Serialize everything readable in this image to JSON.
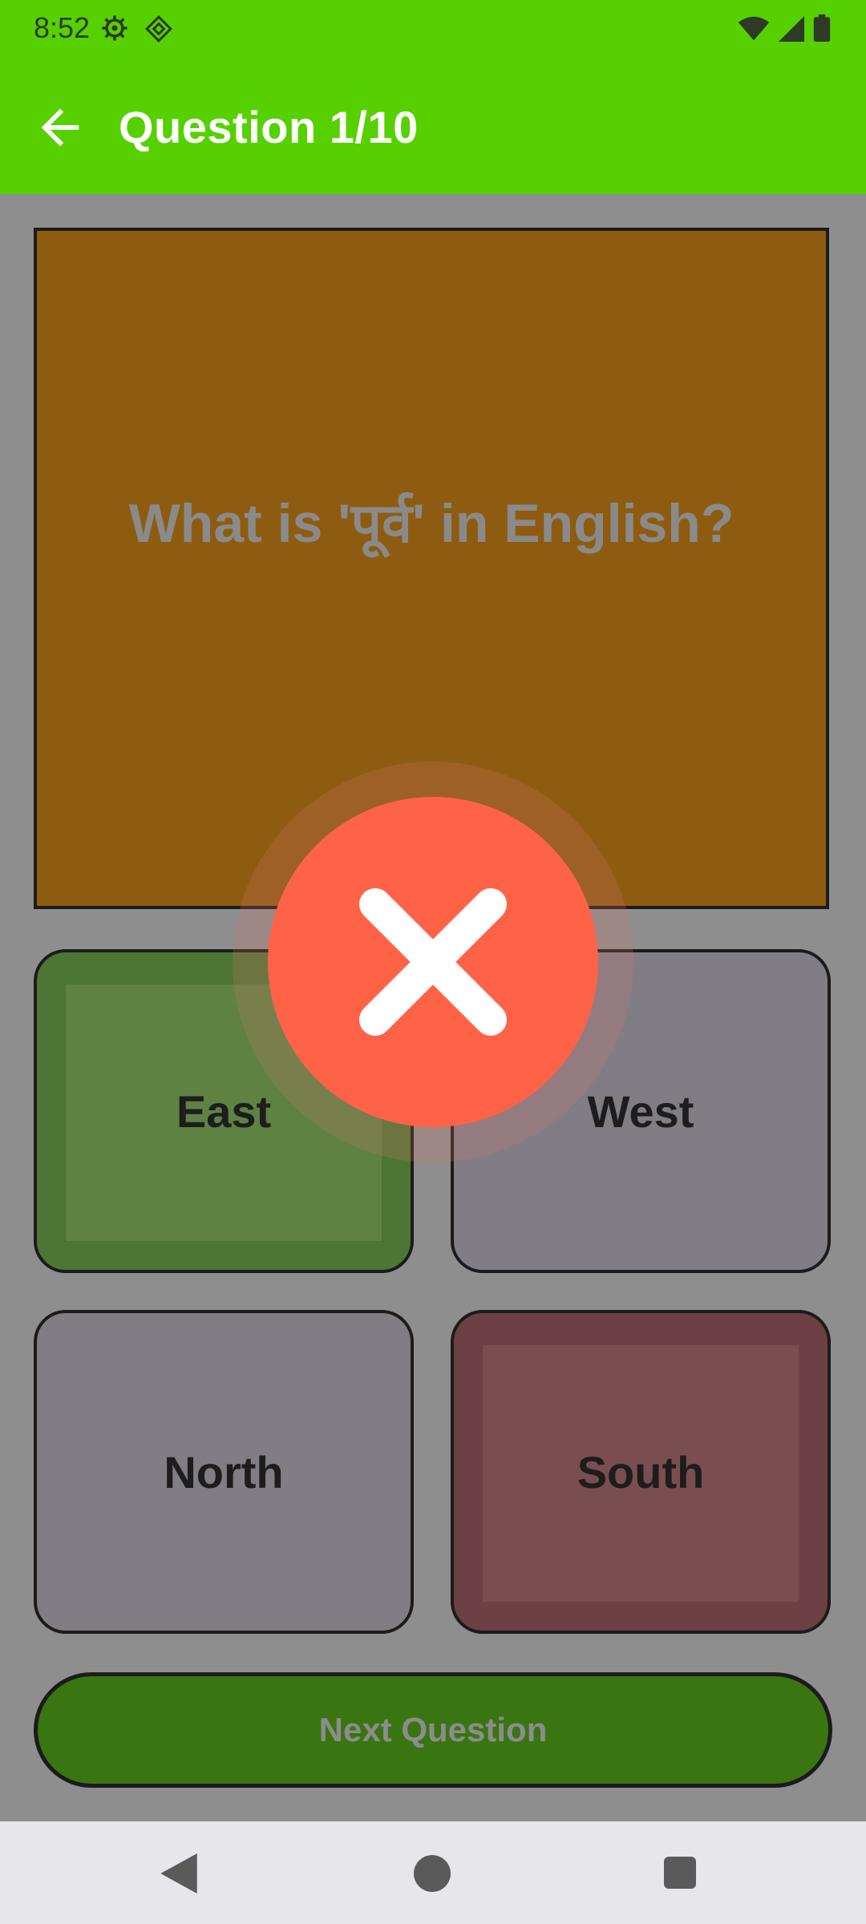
{
  "status_bar": {
    "time": "8:52",
    "left_icons": [
      "settings-icon",
      "notification-icon"
    ],
    "right_icons": [
      "wifi-icon",
      "signal-icon",
      "battery-icon"
    ]
  },
  "app_bar": {
    "title": "Question 1/10",
    "back_icon": "arrow-back-icon",
    "color": "#57d000"
  },
  "question": {
    "text": "What is 'पूर्व' in English?"
  },
  "options": [
    {
      "label": "East",
      "state": "correct"
    },
    {
      "label": "West",
      "state": "neutral"
    },
    {
      "label": "North",
      "state": "neutral"
    },
    {
      "label": "South",
      "state": "wrong-selected"
    }
  ],
  "next_button": {
    "label": "Next Question"
  },
  "feedback": {
    "icon": "close-icon",
    "color": "#ff6347"
  },
  "nav_bar": {
    "buttons": [
      "nav-back-icon",
      "nav-home-icon",
      "nav-recents-icon"
    ]
  }
}
